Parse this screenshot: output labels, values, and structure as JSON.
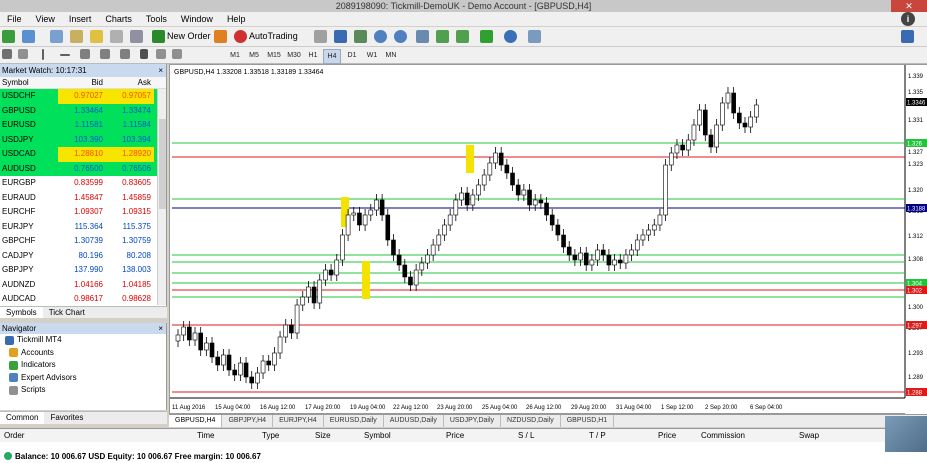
{
  "window": {
    "title": "2089198090: Tickmill-DemoUK - Demo Account - [GBPUSD,H4]"
  },
  "menu": [
    "File",
    "View",
    "Insert",
    "Charts",
    "Tools",
    "Window",
    "Help"
  ],
  "toolbar": {
    "new_order": "New Order",
    "autotrading": "AutoTrading"
  },
  "timeframes": [
    "M1",
    "M5",
    "M15",
    "M30",
    "H1",
    "H4",
    "D1",
    "W1",
    "MN"
  ],
  "timeframe_active": "H4",
  "market_watch": {
    "title": "Market Watch: 10:17:31",
    "columns": [
      "Symbol",
      "Bid",
      "Ask"
    ],
    "rows": [
      {
        "symbol": "USDCHF",
        "bid": "0.97027",
        "ask": "0.97057",
        "style": "green-hi"
      },
      {
        "symbol": "GBPUSD",
        "bid": "1.33464",
        "ask": "1.33474",
        "style": "green"
      },
      {
        "symbol": "EURUSD",
        "bid": "1.11581",
        "ask": "1.11584",
        "style": "green"
      },
      {
        "symbol": "USDJPY",
        "bid": "103.390",
        "ask": "103.394",
        "style": "green"
      },
      {
        "symbol": "USDCAD",
        "bid": "1.28810",
        "ask": "1.28920",
        "style": "green-hi"
      },
      {
        "symbol": "AUDUSD",
        "bid": "0.76500",
        "ask": "0.76506",
        "style": "green"
      },
      {
        "symbol": "EURGBP",
        "bid": "0.83599",
        "ask": "0.83605",
        "style": "red"
      },
      {
        "symbol": "EURAUD",
        "bid": "1.45847",
        "ask": "1.45859",
        "style": "red"
      },
      {
        "symbol": "EURCHF",
        "bid": "1.09307",
        "ask": "1.09315",
        "style": "red"
      },
      {
        "symbol": "EURJPY",
        "bid": "115.364",
        "ask": "115.375",
        "style": "blue"
      },
      {
        "symbol": "GBPCHF",
        "bid": "1.30739",
        "ask": "1.30759",
        "style": "blue"
      },
      {
        "symbol": "CADJPY",
        "bid": "80.196",
        "ask": "80.208",
        "style": "blue"
      },
      {
        "symbol": "GBPJPY",
        "bid": "137.990",
        "ask": "138.003",
        "style": "blue"
      },
      {
        "symbol": "AUDNZD",
        "bid": "1.04166",
        "ask": "1.04185",
        "style": "red"
      },
      {
        "symbol": "AUDCAD",
        "bid": "0.98617",
        "ask": "0.98628",
        "style": "red"
      }
    ],
    "tabs": [
      "Symbols",
      "Tick Chart"
    ]
  },
  "navigator": {
    "title": "Navigator",
    "items": [
      "Tickmill MT4",
      "Accounts",
      "Indicators",
      "Expert Advisors",
      "Scripts"
    ],
    "tabs": [
      "Common",
      "Favorites"
    ]
  },
  "chart": {
    "info": "GBPUSD,H4  1.33208 1.33518 1.33189 1.33464",
    "price_labels": [
      "1.339",
      "1.335",
      "1.331",
      "1.327",
      "1.323",
      "1.320",
      "1.316",
      "1.312",
      "1.308",
      "1.304",
      "1.300",
      "1.297",
      "1.293",
      "1.289"
    ],
    "current_price": "1.3346",
    "line_labels": [
      "1.326",
      "1.3188",
      "1.304",
      "1.302",
      "1.297",
      "1.288"
    ],
    "time_labels": [
      "11 Aug 2016",
      "15 Aug 04:00",
      "16 Aug 12:00",
      "17 Aug 20:00",
      "19 Aug 04:00",
      "22 Aug 12:00",
      "23 Aug 20:00",
      "25 Aug 04:00",
      "26 Aug 12:00",
      "29 Aug 20:00",
      "31 Aug 04:00",
      "1 Sep 12:00",
      "2 Sep 20:00",
      "6 Sep 04:00"
    ],
    "tabs": [
      "GBPUSD,H4",
      "GBPJPY,H4",
      "EURJPY,H4",
      "EURUSD,Daily",
      "AUDUSD,Daily",
      "USDJPY,Daily",
      "NZDUSD,Daily",
      "GBPUSD,H1"
    ],
    "colors": {
      "hline_green": "#22c43a",
      "hline_red": "#e01919",
      "hline_navy": "#000080",
      "highlight": "#f2e400"
    }
  },
  "terminal": {
    "columns": [
      "Order",
      "Time",
      "Type",
      "Size",
      "Symbol",
      "Price",
      "S / L",
      "T / P",
      "Price",
      "Commission",
      "Swap"
    ],
    "balance": "Balance: 10 006.67 USD  Equity: 10 006.67  Free margin: 10 006.67"
  }
}
